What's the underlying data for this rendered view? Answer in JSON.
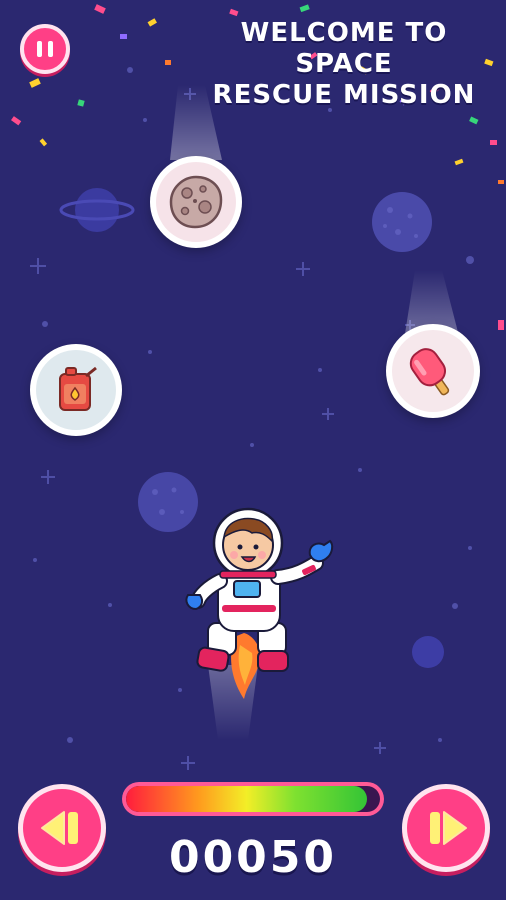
{
  "screen": {
    "title_line1": "WELCOME TO SPACE",
    "title_line2": "RESCUE MISSION",
    "score": "00050",
    "fuel_level": 0.95,
    "pause_icon": "pause-icon",
    "prev_icon": "rewind-icon",
    "next_icon": "play-forward-icon"
  },
  "items": [
    {
      "name": "asteroid",
      "icon": "asteroid-icon"
    },
    {
      "name": "fuel-can",
      "icon": "fuel-can-icon"
    },
    {
      "name": "popsicle",
      "icon": "popsicle-icon"
    }
  ],
  "player": {
    "name": "astronaut",
    "icon": "astronaut-icon"
  },
  "colors": {
    "background": "#2b2870",
    "button_pink": "#ff3f86",
    "bar_start": "#ff1d3d",
    "bar_end": "#34c436"
  }
}
